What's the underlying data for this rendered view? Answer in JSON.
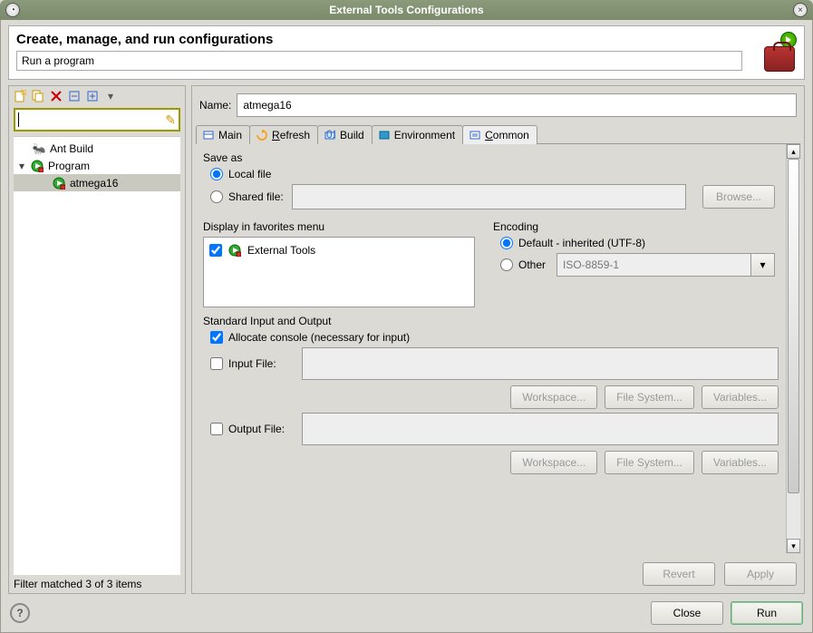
{
  "window": {
    "title": "External Tools Configurations"
  },
  "header": {
    "main_text": "Create, manage, and run configurations",
    "sub_text": "Run a program"
  },
  "left": {
    "tree": {
      "ant_build": "Ant Build",
      "program": "Program",
      "atmega16": "atmega16"
    },
    "filter_status": "Filter matched 3 of 3 items"
  },
  "name": {
    "label": "Name:",
    "value": "atmega16"
  },
  "tabs": {
    "main": "Main",
    "refresh": "Refresh",
    "build": "Build",
    "environment": "Environment",
    "common": "Common"
  },
  "saveas": {
    "title": "Save as",
    "local": "Local file",
    "shared": "Shared file:",
    "browse": "Browse..."
  },
  "favorites": {
    "title": "Display in favorites menu",
    "external_tools": "External Tools"
  },
  "encoding": {
    "title": "Encoding",
    "default": "Default - inherited (UTF-8)",
    "other": "Other",
    "other_value": "ISO-8859-1"
  },
  "io": {
    "title": "Standard Input and Output",
    "allocate": "Allocate console (necessary for input)",
    "input_file": "Input File:",
    "output_file": "Output File:",
    "workspace": "Workspace...",
    "filesystem": "File System...",
    "variables": "Variables..."
  },
  "buttons": {
    "revert": "Revert",
    "apply": "Apply",
    "close": "Close",
    "run": "Run"
  }
}
